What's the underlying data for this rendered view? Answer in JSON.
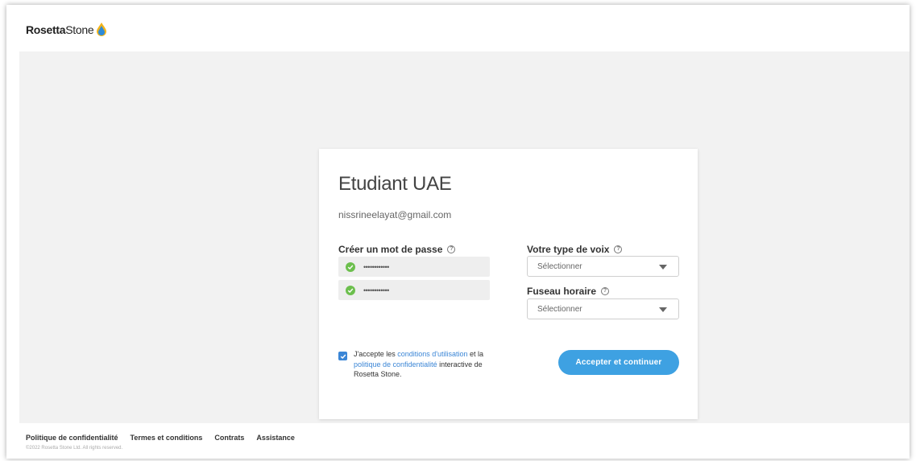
{
  "brand": {
    "name_bold": "Rosetta",
    "name_light": "Stone"
  },
  "card": {
    "title": "Etudiant UAE",
    "email": "nissrineelayat@gmail.com"
  },
  "password": {
    "label": "Créer un mot de passe",
    "field1_value": "••••••••••••",
    "field2_value": "••••••••••••"
  },
  "voice": {
    "label": "Votre type de voix",
    "selected": "Sélectionner"
  },
  "timezone": {
    "label": "Fuseau horaire",
    "selected": "Sélectionner"
  },
  "agreement": {
    "checked": true,
    "text_1": "J'accepte les ",
    "link_terms": "conditions d'utilisation",
    "text_2": " et la ",
    "link_privacy": "politique de confidentialité",
    "text_3": " interactive de Rosetta Stone."
  },
  "submit_label": "Accepter et continuer",
  "footer": {
    "links": [
      "Politique de confidentialité",
      "Termes et conditions",
      "Contrats",
      "Assistance"
    ],
    "copyright": "©2022 Rosetta Stone Ltd. All rights reserved."
  },
  "colors": {
    "accent": "#3ea1e2",
    "link": "#3b86d6",
    "success": "#6cbf4d",
    "background": "#f2f2f2"
  },
  "icons": {
    "help": "question-circle-icon",
    "valid": "check-circle-icon",
    "dropdown": "caret-down-icon",
    "logo": "rosetta-stone-drop-icon"
  }
}
